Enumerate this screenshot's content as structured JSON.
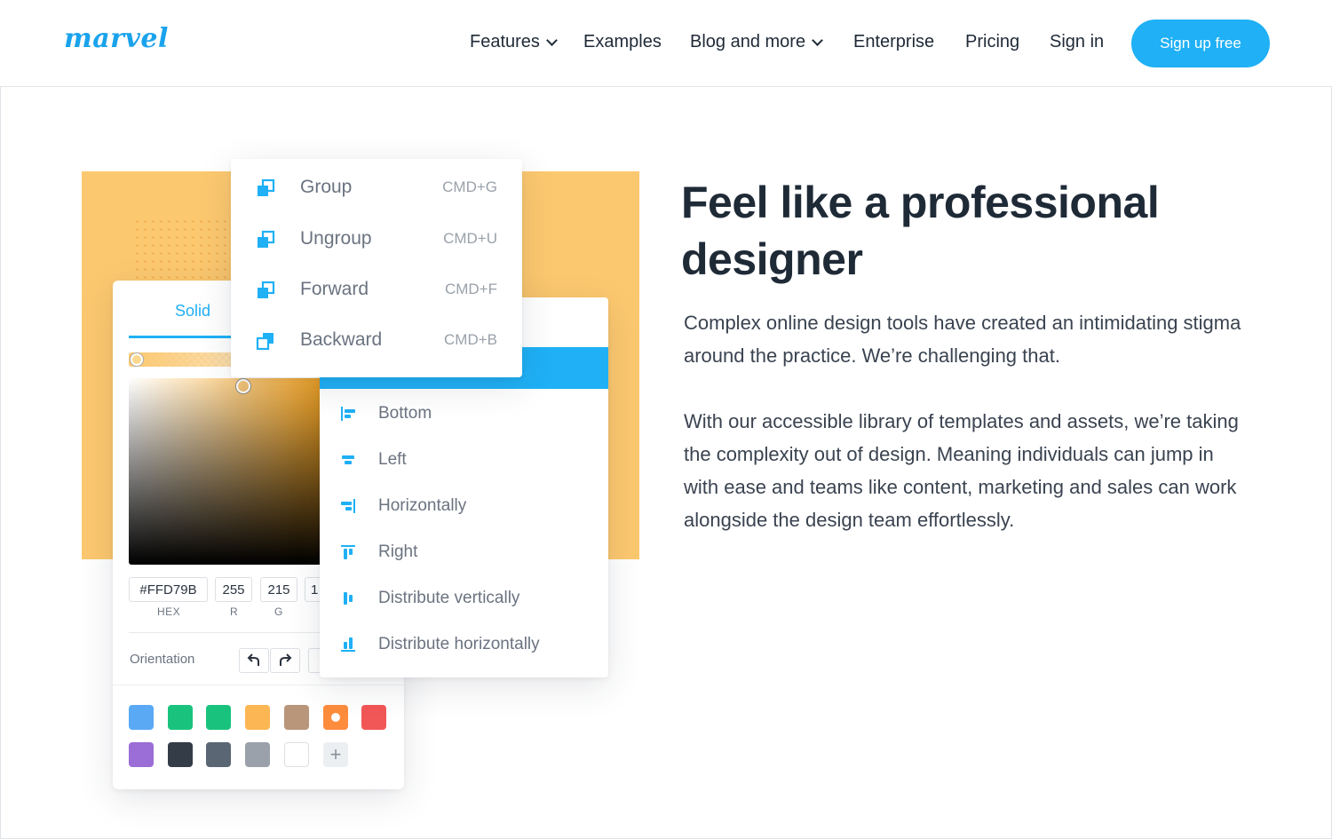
{
  "header": {
    "logo_text": "marvel",
    "nav": [
      {
        "label": "Features",
        "dropdown": true
      },
      {
        "label": "Examples",
        "dropdown": false
      },
      {
        "label": "Blog and more",
        "dropdown": true
      },
      {
        "label": "Enterprise",
        "dropdown": false
      },
      {
        "label": "Pricing",
        "dropdown": false
      },
      {
        "label": "Sign in",
        "dropdown": false
      }
    ],
    "signup_label": "Sign up free"
  },
  "group_menu": {
    "items": [
      {
        "label": "Group",
        "shortcut": "CMD+G"
      },
      {
        "label": "Ungroup",
        "shortcut": "CMD+U"
      },
      {
        "label": "Forward",
        "shortcut": "CMD+F"
      },
      {
        "label": "Backward",
        "shortcut": "CMD+B"
      }
    ]
  },
  "align_menu": {
    "items": [
      {
        "label": "Bottom"
      },
      {
        "label": "Left"
      },
      {
        "label": "Horizontally"
      },
      {
        "label": "Right"
      },
      {
        "label": "Distribute vertically"
      },
      {
        "label": "Distribute horizontally"
      }
    ]
  },
  "color_picker": {
    "tab_label": "Solid",
    "hex_value": "#FFD79B",
    "hex_label": "HEX",
    "r_value": "255",
    "r_label": "R",
    "g_value": "215",
    "g_label": "G",
    "b_value_partial": "1",
    "orientation_label": "Orientation",
    "swatches": [
      "#5aa9f5",
      "#19c37d",
      "#19c37d",
      "#fcb653",
      "#b9967a",
      "#fd8c3d",
      "#f25757",
      "#9b6dd6",
      "#343c48",
      "#5b6674",
      "#9aa1aa",
      "#ffffff"
    ],
    "add_symbol": "+"
  },
  "hero": {
    "headline": "Feel like a professional designer",
    "paragraph_1": "Complex online design tools have created an intimidating stigma around the practice. We’re challenging that.",
    "paragraph_2": "With our accessible library of templates and assets, we’re taking the complexity out of design. Meaning individuals can jump in with ease and teams like content, marketing and sales can work alongside the design team effortlessly."
  },
  "colors": {
    "accent": "#1fb0f5",
    "illustration_bg": "#fcc86f",
    "text_dark": "#1f2a37"
  }
}
